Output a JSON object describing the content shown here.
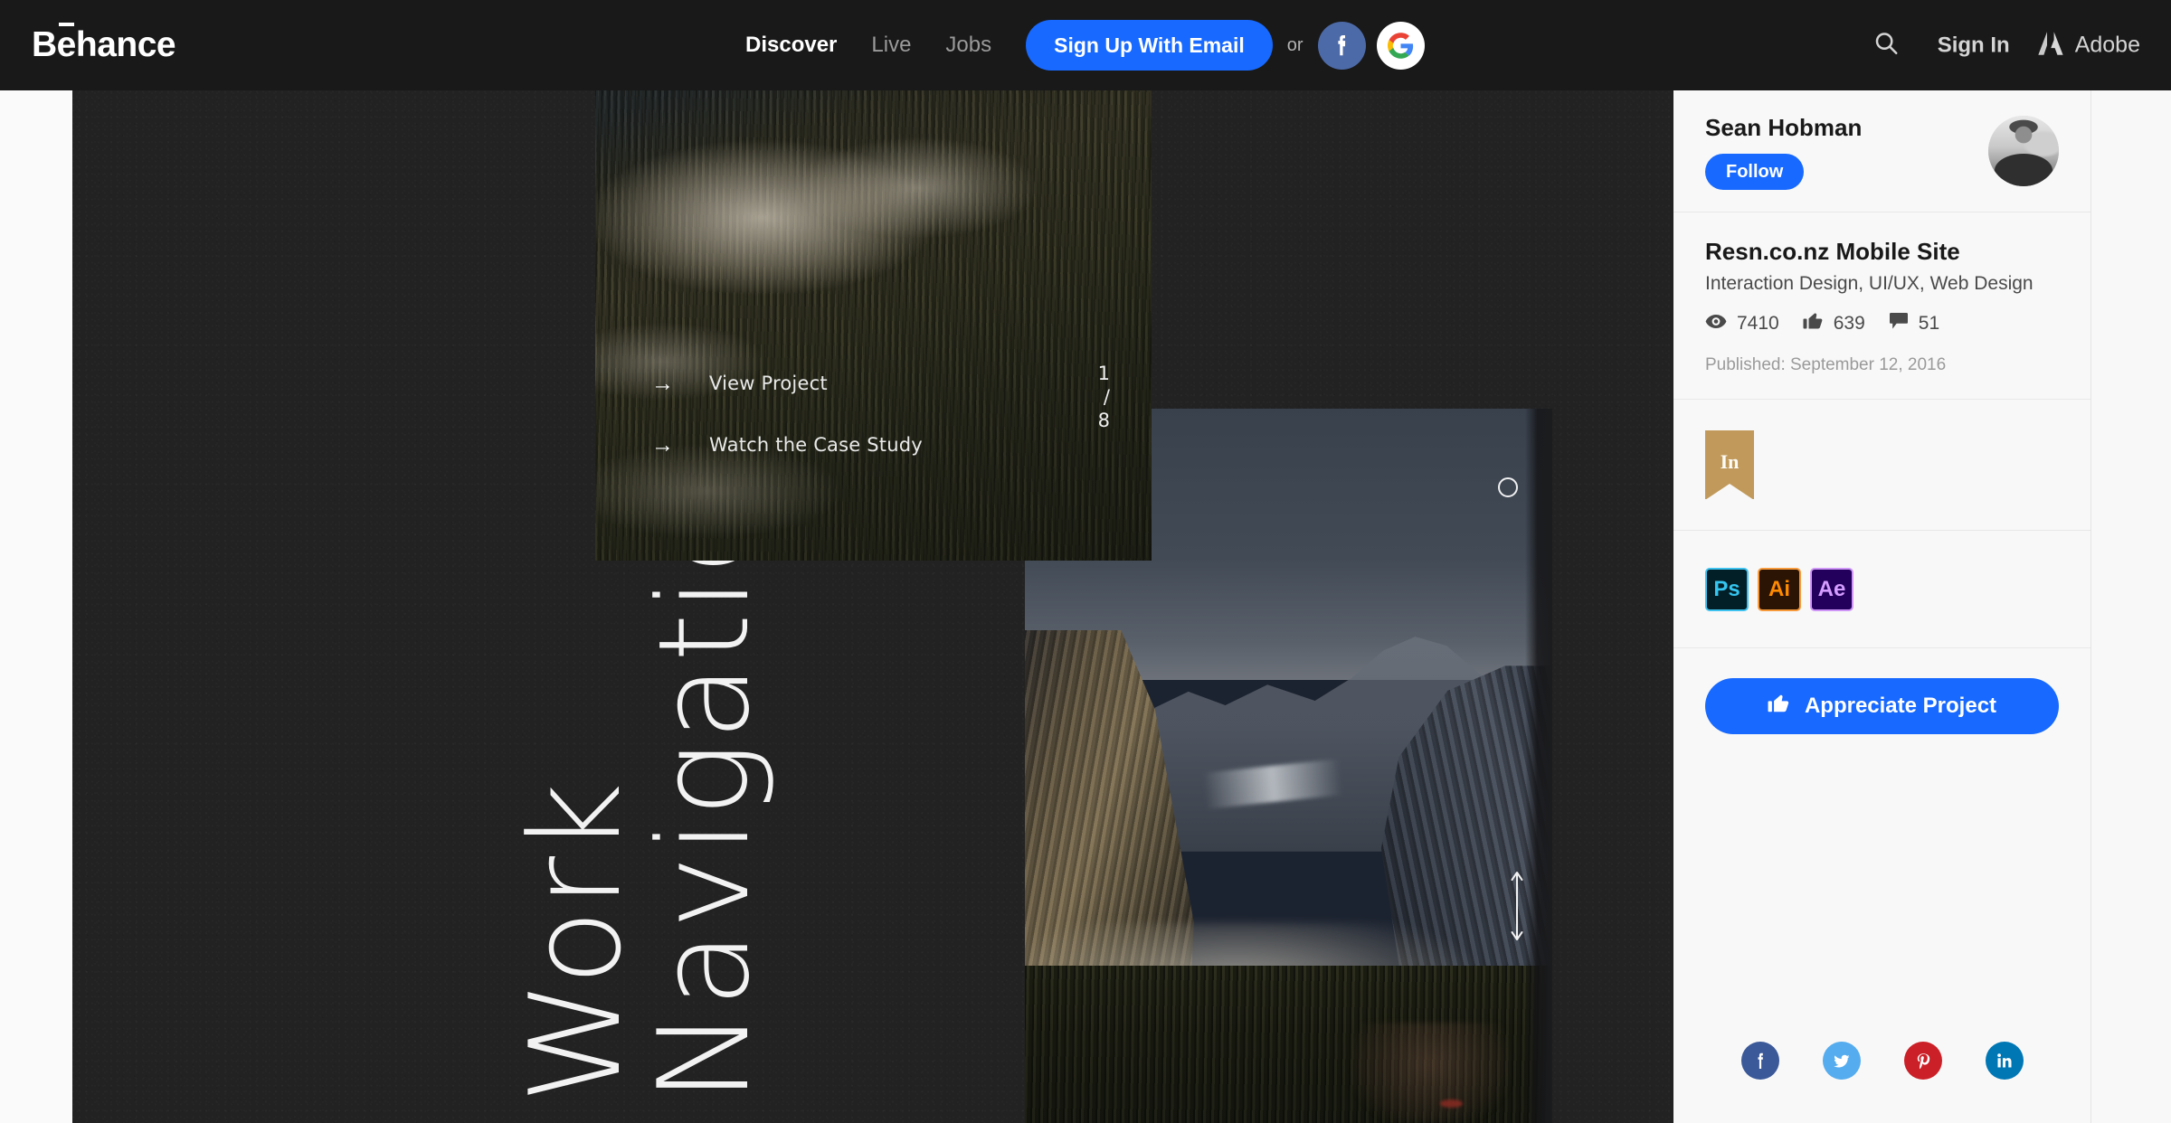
{
  "header": {
    "logo": "Behance",
    "nav": [
      {
        "label": "Discover",
        "active": true
      },
      {
        "label": "Live",
        "active": false
      },
      {
        "label": "Jobs",
        "active": false
      }
    ],
    "signup_label": "Sign Up With Email",
    "or_label": "or",
    "facebook_icon": "facebook-icon",
    "google_icon": "google-icon",
    "search_icon": "search-icon",
    "signin_label": "Sign In",
    "adobe_label": "Adobe",
    "accent_blue": "#1769FF",
    "bar_color": "#191919"
  },
  "canvas": {
    "background": "#222222",
    "vertical_text": {
      "line1": "Work",
      "line2": "Navigation"
    },
    "overlay_menu": [
      {
        "arrow": "→",
        "label": "View Project"
      },
      {
        "arrow": "→",
        "label": "Watch the Case Study"
      }
    ],
    "pager": {
      "current": "1",
      "separator": "/",
      "total": "8"
    },
    "circle_button": "circle-outline-icon",
    "scroll_arrow": "vertical-double-arrow-icon"
  },
  "sidebar": {
    "author": {
      "name": "Sean Hobman",
      "follow_label": "Follow",
      "avatar": "user-avatar"
    },
    "project": {
      "title": "Resn.co.nz Mobile Site",
      "fields": "Interaction Design, UI/UX, Web Design",
      "stats": [
        {
          "icon": "eye-icon",
          "value": "7410"
        },
        {
          "icon": "thumbs-up-icon",
          "value": "639"
        },
        {
          "icon": "comment-icon",
          "value": "51"
        }
      ],
      "published": "Published: September 12, 2016"
    },
    "badge": {
      "label": "In",
      "color": "#C19A5B"
    },
    "tools": [
      {
        "name": "Ps",
        "id": "tool-ps",
        "bg": "#021E26",
        "fg": "#34C5F0"
      },
      {
        "name": "Ai",
        "id": "tool-ai",
        "bg": "#2B1403",
        "fg": "#FF8A00"
      },
      {
        "name": "Ae",
        "id": "tool-ae",
        "bg": "#22005C",
        "fg": "#D59CFF"
      }
    ],
    "appreciate": {
      "label": "Appreciate Project",
      "icon": "thumbs-up-icon",
      "color": "#1769FF"
    },
    "share": [
      {
        "icon": "facebook-icon",
        "color": "#3B5998"
      },
      {
        "icon": "twitter-icon",
        "color": "#55ACEE"
      },
      {
        "icon": "pinterest-icon",
        "color": "#CB2027"
      },
      {
        "icon": "linkedin-icon",
        "color": "#0077B5"
      }
    ]
  }
}
